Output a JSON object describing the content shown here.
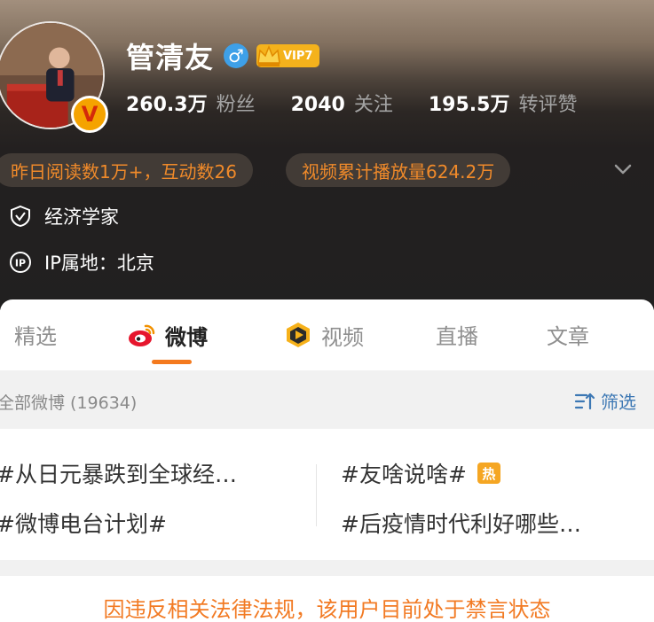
{
  "profile": {
    "name": "管清友",
    "vip_label": "VIP7",
    "verified_badge": "V",
    "stats": [
      {
        "value": "260.3万",
        "label": "粉丝"
      },
      {
        "value": "2040",
        "label": "关注"
      },
      {
        "value": "195.5万",
        "label": "转评赞"
      }
    ],
    "highlights": [
      "昨日阅读数1万+，互动数26",
      "视频累计播放量624.2万"
    ],
    "title": "经济学家",
    "ip_location": "IP属地：北京"
  },
  "tabs": [
    {
      "label": "精选",
      "active": false
    },
    {
      "label": "微博",
      "active": true,
      "icon": "weibo-icon"
    },
    {
      "label": "视频",
      "active": false,
      "icon": "video-icon"
    },
    {
      "label": "直播",
      "active": false
    },
    {
      "label": "文章",
      "active": false
    }
  ],
  "feed": {
    "all_label": "全部微博 (19634)",
    "filter_label": "筛选"
  },
  "topics": [
    {
      "text": "#从日元暴跌到全球经…"
    },
    {
      "text": "#友啥说啥#",
      "badge": "热"
    },
    {
      "text": "#微博电台计划#"
    },
    {
      "text": "#后疫情时代利好哪些…"
    }
  ],
  "notice": "因违反相关法律法规，该用户目前处于禁言状态",
  "colors": {
    "accent_orange": "#f47a1e",
    "notice_orange": "#f27a23",
    "filter_blue": "#3d78b4",
    "vip_gold": "#f4b21c",
    "gender_blue": "#3ea0e8"
  }
}
